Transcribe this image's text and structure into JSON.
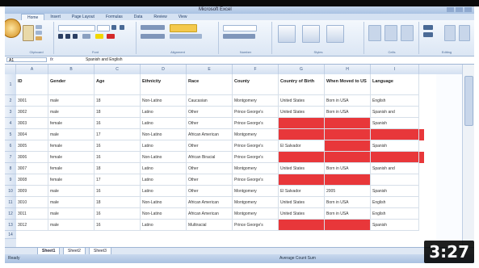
{
  "window": {
    "title": "Microsoft Excel"
  },
  "ribbon": {
    "tabs": [
      "Home",
      "Insert",
      "Page Layout",
      "Formulas",
      "Data",
      "Review",
      "View"
    ],
    "groups": [
      "Clipboard",
      "Font",
      "Alignment",
      "Number",
      "Styles",
      "Cells",
      "Editing"
    ]
  },
  "formula_bar": {
    "name_box": "A1",
    "fx": "fx",
    "value": "Spanish and English"
  },
  "columns": [
    "A",
    "B",
    "C",
    "D",
    "E",
    "F",
    "G",
    "H",
    "I"
  ],
  "table": {
    "headers": [
      "ID",
      "Gender",
      "Age",
      "Ethnicity",
      "Race",
      "County",
      "Country of Birth",
      "When Moved to US",
      "Language"
    ],
    "rows": [
      [
        "3001",
        "male",
        "18",
        "Non-Latino",
        "Caucasian",
        "Montgomery",
        "United States",
        "Born in USA",
        "English"
      ],
      [
        "3002",
        "male",
        "18",
        "Latino",
        "Other",
        "Prince George's",
        "United States",
        "Born in USA",
        "Spanish and"
      ],
      [
        "3003",
        "female",
        "16",
        "Latino",
        "Other",
        "Prince George's",
        "",
        "",
        "Spanish"
      ],
      [
        "3004",
        "male",
        "17",
        "Non-Latino",
        "African American",
        "Montgomery",
        "",
        "",
        ""
      ],
      [
        "3005",
        "female",
        "16",
        "Latino",
        "Other",
        "Prince George's",
        "El Salvador",
        "",
        "Spanish"
      ],
      [
        "3006",
        "female",
        "16",
        "Non-Latino",
        "African Biracial",
        "Prince George's",
        "",
        "",
        ""
      ],
      [
        "3007",
        "female",
        "18",
        "Latino",
        "Other",
        "Montgomery",
        "United States",
        "Born in USA",
        "Spanish and"
      ],
      [
        "3008",
        "female",
        "17",
        "Latino",
        "Other",
        "Prince George's",
        "",
        "",
        ""
      ],
      [
        "3009",
        "male",
        "16",
        "Latino",
        "Other",
        "Montgomery",
        "El Salvador",
        "2005",
        "Spanish"
      ],
      [
        "3010",
        "male",
        "18",
        "Non-Latino",
        "African American",
        "Montgomery",
        "United States",
        "Born in USA",
        "English"
      ],
      [
        "3011",
        "male",
        "16",
        "Non-Latino",
        "African American",
        "Montgomery",
        "United States",
        "Born in USA",
        "English"
      ],
      [
        "3012",
        "male",
        "16",
        "Latino",
        "Multiracial",
        "Prince George's",
        "",
        "",
        "Spanish"
      ]
    ]
  },
  "row_numbers": [
    "1",
    "2",
    "3",
    "4",
    "5",
    "6",
    "7",
    "8",
    "9",
    "10",
    "11",
    "12",
    "13",
    "14"
  ],
  "sheets": [
    "Sheet1",
    "Sheet2",
    "Sheet3"
  ],
  "status": {
    "ready": "Ready",
    "summary": "Average   Count   Sum"
  },
  "video": {
    "duration": "3:27"
  },
  "colors": {
    "highlight": "#e8373a",
    "ribbon": "#dbe6f4"
  }
}
